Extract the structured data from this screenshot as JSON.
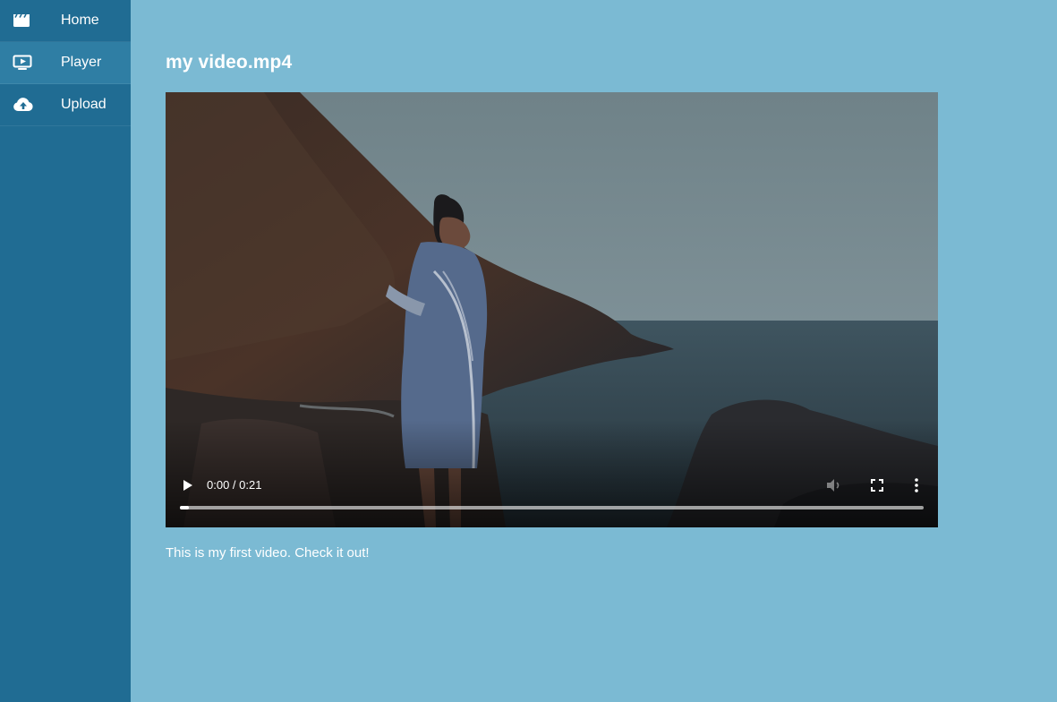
{
  "sidebar": {
    "items": [
      {
        "label": "Home",
        "icon": "clapperboard-icon",
        "active": false
      },
      {
        "label": "Player",
        "icon": "tv-play-icon",
        "active": true
      },
      {
        "label": "Upload",
        "icon": "cloud-upload-icon",
        "active": false
      }
    ]
  },
  "main": {
    "title": "my video.mp4",
    "description": "This is my first video. Check it out!"
  },
  "player": {
    "time": "0:00 / 0:21",
    "progress_fraction": 0.0,
    "icons": [
      "play-icon",
      "volume-icon",
      "fullscreen-icon",
      "more-vertical-icon"
    ]
  },
  "colors": {
    "sidebar_bg": "#206c93",
    "sidebar_active_bg": "#2f7ea4",
    "main_bg": "#7bbad3",
    "text": "#ffffff"
  }
}
